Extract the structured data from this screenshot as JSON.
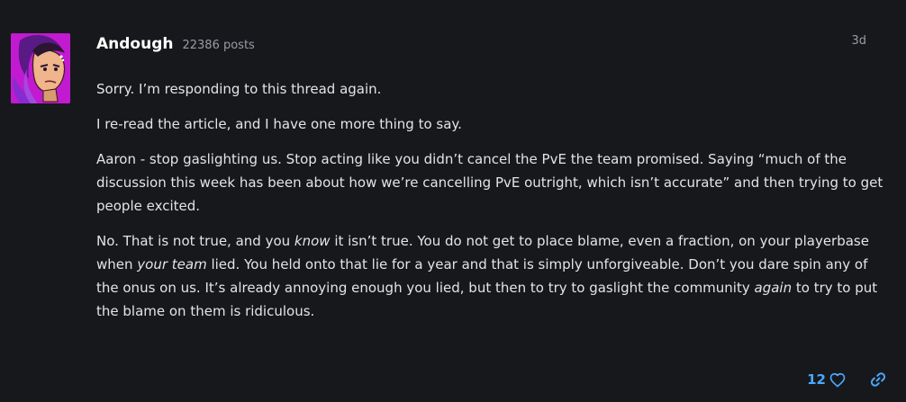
{
  "post": {
    "author": {
      "username": "Andough",
      "post_count": "22386 posts"
    },
    "date": "3d",
    "paragraphs": [
      [
        {
          "text": "Sorry. I’m responding to this thread again."
        }
      ],
      [
        {
          "text": "I re-read the article, and I have one more thing to say."
        }
      ],
      [
        {
          "text": "Aaron - stop gaslighting us. Stop acting like you didn’t cancel the PvE the team promised. Saying “much of the discussion this week has been about how we’re cancelling PvE outright, which isn’t accurate” and then trying to get people excited."
        }
      ],
      [
        {
          "text": "No. That is not true, and you "
        },
        {
          "text": "know",
          "em": true
        },
        {
          "text": " it isn’t true. You do not get to place blame, even a fraction, on your playerbase when "
        },
        {
          "text": "your team",
          "em": true
        },
        {
          "text": " lied. You held onto that lie for a year and that is simply unforgiveable. Don’t you dare spin any of the onus on us. It’s already annoying enough you lied, but then to try to gaslight the community "
        },
        {
          "text": "again",
          "em": true
        },
        {
          "text": " to try to put the blame on them is ridiculous."
        }
      ]
    ],
    "likes": {
      "count": "12",
      "icon": "heart-outline-icon"
    },
    "link_icon": "link-icon",
    "colors": {
      "background": "#17181c",
      "accent": "#4aa8ff",
      "muted": "#9a9ca4",
      "avatar_bg": "#c21ad0"
    }
  }
}
